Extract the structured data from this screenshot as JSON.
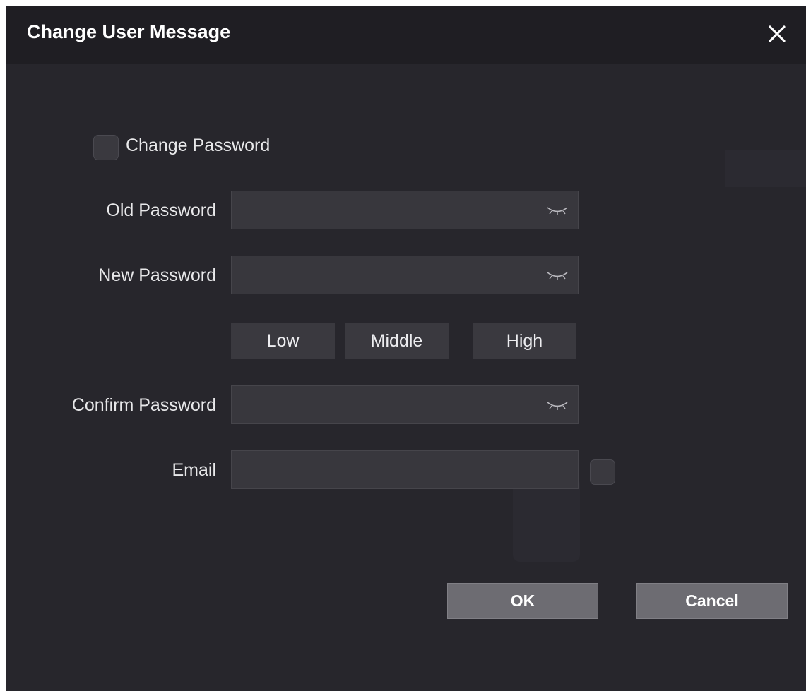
{
  "dialog": {
    "title": "Change User Message"
  },
  "change_password": {
    "label": "Change Password",
    "checked": false
  },
  "fields": {
    "old_password": {
      "label": "Old Password",
      "value": ""
    },
    "new_password": {
      "label": "New Password",
      "value": ""
    },
    "confirm_password": {
      "label": "Confirm Password",
      "value": ""
    },
    "email": {
      "label": "Email",
      "value": ""
    }
  },
  "strength": {
    "low": "Low",
    "middle": "Middle",
    "high": "High"
  },
  "buttons": {
    "ok": "OK",
    "cancel": "Cancel"
  },
  "icons": {
    "close": "close-icon",
    "eye": "eye-closed-icon"
  },
  "colors": {
    "dialog_bg": "#27262c",
    "titlebar_bg": "#1f1e23",
    "input_bg": "#38373d",
    "button_bg": "#6d6c72"
  }
}
